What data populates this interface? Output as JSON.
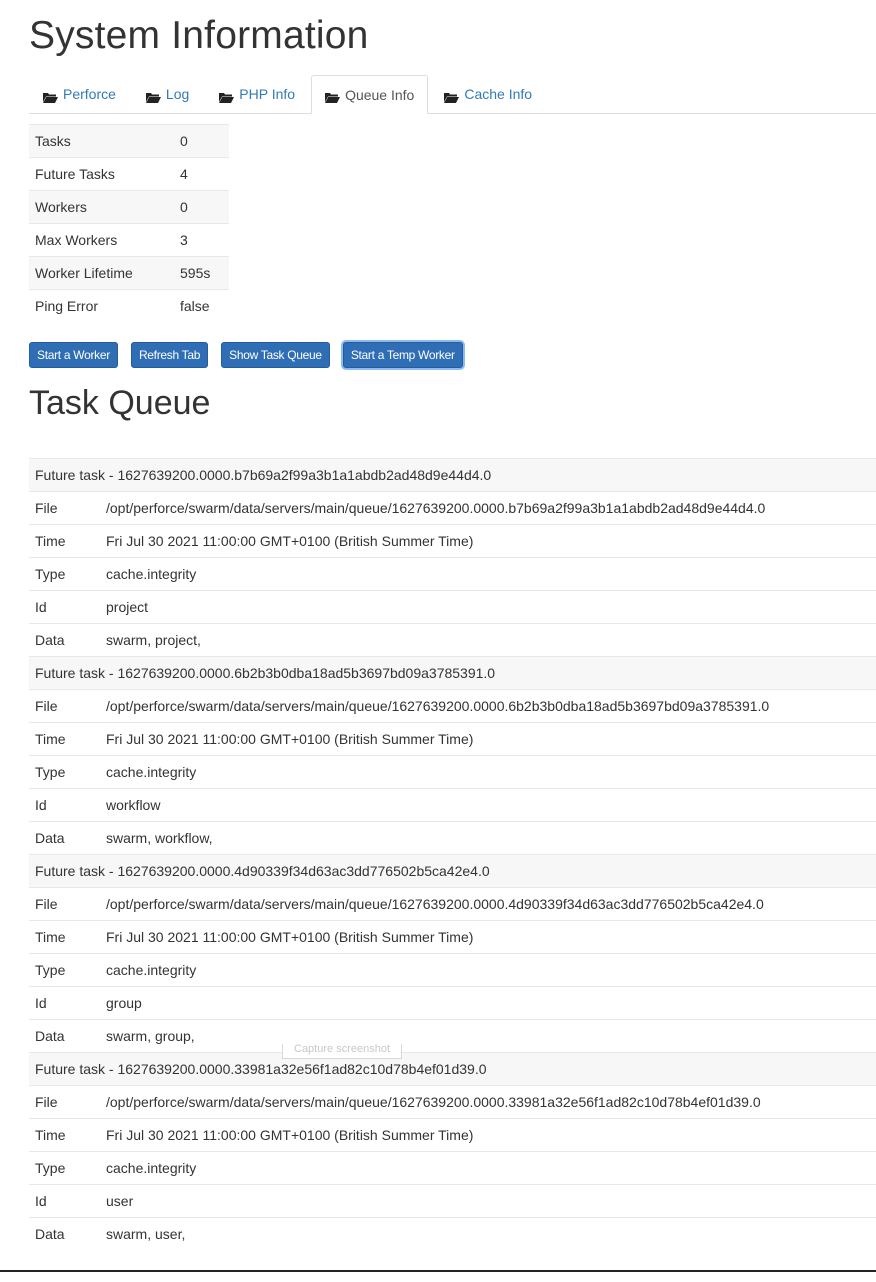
{
  "page_title": "System Information",
  "tabs": [
    {
      "label": "Perforce",
      "icon": "folder-open-icon",
      "active": false
    },
    {
      "label": "Log",
      "icon": "folder-open-icon",
      "active": false
    },
    {
      "label": "PHP Info",
      "icon": "folder-open-icon",
      "active": false
    },
    {
      "label": "Queue Info",
      "icon": "folder-open-icon",
      "active": true
    },
    {
      "label": "Cache Info",
      "icon": "folder-open-icon",
      "active": false
    }
  ],
  "stats": [
    {
      "label": "Tasks",
      "value": "0"
    },
    {
      "label": "Future Tasks",
      "value": "4"
    },
    {
      "label": "Workers",
      "value": "0"
    },
    {
      "label": "Max Workers",
      "value": "3"
    },
    {
      "label": "Worker Lifetime",
      "value": "595s"
    },
    {
      "label": "Ping Error",
      "value": "false"
    }
  ],
  "buttons": {
    "start_worker": "Start a Worker",
    "refresh_tab": "Refresh Tab",
    "show_task_queue": "Show Task Queue",
    "start_temp_worker": "Start a Temp Worker"
  },
  "task_queue": {
    "title": "Task Queue",
    "field_labels": {
      "file": "File",
      "time": "Time",
      "type": "Type",
      "id": "Id",
      "data": "Data"
    },
    "tasks": [
      {
        "header": "Future task - 1627639200.0000.b7b69a2f99a3b1a1abdb2ad48d9e44d4.0",
        "file": "/opt/perforce/swarm/data/servers/main/queue/1627639200.0000.b7b69a2f99a3b1a1abdb2ad48d9e44d4.0",
        "time": "Fri Jul 30 2021 11:00:00 GMT+0100 (British Summer Time)",
        "type": "cache.integrity",
        "id": "project",
        "data": "swarm, project,"
      },
      {
        "header": "Future task - 1627639200.0000.6b2b3b0dba18ad5b3697bd09a3785391.0",
        "file": "/opt/perforce/swarm/data/servers/main/queue/1627639200.0000.6b2b3b0dba18ad5b3697bd09a3785391.0",
        "time": "Fri Jul 30 2021 11:00:00 GMT+0100 (British Summer Time)",
        "type": "cache.integrity",
        "id": "workflow",
        "data": "swarm, workflow,"
      },
      {
        "header": "Future task - 1627639200.0000.4d90339f34d63ac3dd776502b5ca42e4.0",
        "file": "/opt/perforce/swarm/data/servers/main/queue/1627639200.0000.4d90339f34d63ac3dd776502b5ca42e4.0",
        "time": "Fri Jul 30 2021 11:00:00 GMT+0100 (British Summer Time)",
        "type": "cache.integrity",
        "id": "group",
        "data": "swarm, group,"
      },
      {
        "header": "Future task - 1627639200.0000.33981a32e56f1ad82c10d78b4ef01d39.0",
        "file": "/opt/perforce/swarm/data/servers/main/queue/1627639200.0000.33981a32e56f1ad82c10d78b4ef01d39.0",
        "time": "Fri Jul 30 2021 11:00:00 GMT+0100 (British Summer Time)",
        "type": "cache.integrity",
        "id": "user",
        "data": "swarm, user,"
      }
    ]
  },
  "tooltip": "Capture screenshot"
}
